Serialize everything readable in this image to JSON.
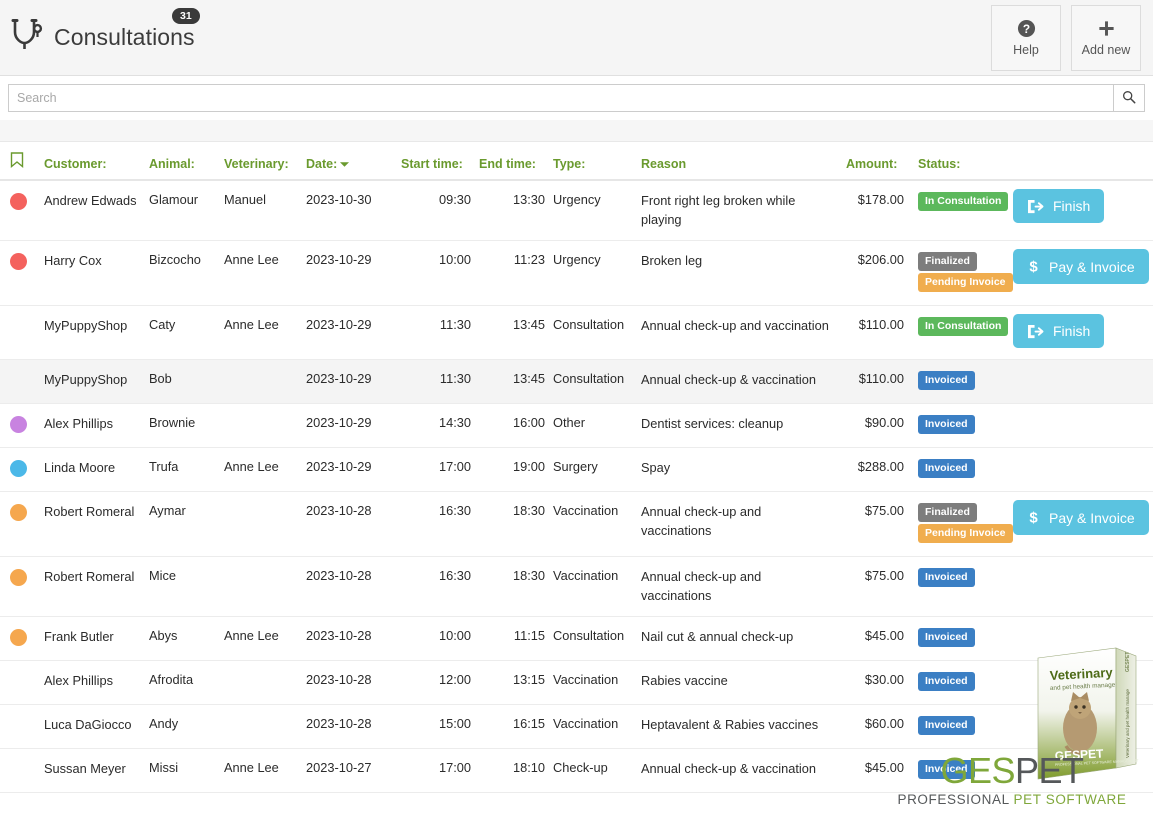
{
  "header": {
    "title": "Consultations",
    "badge_count": "31",
    "icon": "stethoscope-icon",
    "buttons": [
      {
        "label": "Help",
        "icon": "question-circle-icon"
      },
      {
        "label": "Add new",
        "icon": "plus-icon"
      }
    ]
  },
  "search": {
    "placeholder": "Search",
    "value": "",
    "button_icon": "search-icon"
  },
  "table": {
    "flag_icon": "bookmark-icon",
    "columns": {
      "customer": "Customer:",
      "animal": "Animal:",
      "veterinary": "Veterinary:",
      "date": "Date:",
      "date_sort": "descending",
      "start_time": "Start time:",
      "end_time": "End time:",
      "type": "Type:",
      "reason": "Reason",
      "amount": "Amount:",
      "status": "Status:"
    },
    "rows": [
      {
        "dot": "#f4625e",
        "customer": "Andrew Edwads",
        "animal": "Glamour",
        "veterinary": "Manuel",
        "date": "2023-10-30",
        "start": "09:30",
        "end": "13:30",
        "type": "Urgency",
        "type_style": "urgency",
        "reason": "Front right leg broken while playing",
        "amount": "$178.00",
        "badges": [
          {
            "label": "In Consultation",
            "style": "b-inconsult"
          }
        ],
        "action": {
          "label": "Finish",
          "icon": "sign-out-icon"
        },
        "highlight": false
      },
      {
        "dot": "#f4625e",
        "customer": "Harry Cox",
        "animal": "Bizcocho",
        "veterinary": "Anne Lee",
        "date": "2023-10-29",
        "start": "10:00",
        "end": "11:23",
        "type": "Urgency",
        "type_style": "urgency",
        "reason": "Broken leg",
        "amount": "$206.00",
        "badges": [
          {
            "label": "Finalized",
            "style": "b-finalized"
          },
          {
            "label": "Pending Invoice",
            "style": "b-pending"
          }
        ],
        "action": {
          "label": "Pay & Invoice",
          "icon": "dollar-icon"
        },
        "highlight": false
      },
      {
        "dot": "",
        "customer": "MyPuppyShop",
        "animal": "Caty",
        "veterinary": "Anne Lee",
        "date": "2023-10-29",
        "start": "11:30",
        "end": "13:45",
        "type": "Consultation",
        "type_style": "",
        "reason": "Annual check-up and vaccination",
        "amount": "$110.00",
        "badges": [
          {
            "label": "In Consultation",
            "style": "b-inconsult"
          }
        ],
        "action": {
          "label": "Finish",
          "icon": "sign-out-icon"
        },
        "highlight": false
      },
      {
        "dot": "",
        "customer": "MyPuppyShop",
        "animal": "Bob",
        "veterinary": "",
        "date": "2023-10-29",
        "start": "11:30",
        "end": "13:45",
        "type": "Consultation",
        "type_style": "",
        "reason": "Annual check-up & vaccination",
        "amount": "$110.00",
        "badges": [
          {
            "label": "Invoiced",
            "style": "b-invoiced"
          }
        ],
        "action": null,
        "highlight": true
      },
      {
        "dot": "#c883e0",
        "customer": "Alex Phillips",
        "animal": "Brownie",
        "veterinary": "",
        "date": "2023-10-29",
        "start": "14:30",
        "end": "16:00",
        "type": "Other",
        "type_style": "",
        "reason": "Dentist services: cleanup",
        "amount": "$90.00",
        "badges": [
          {
            "label": "Invoiced",
            "style": "b-invoiced"
          }
        ],
        "action": null,
        "highlight": false
      },
      {
        "dot": "#4bb8e8",
        "customer": "Linda Moore",
        "animal": "Trufa",
        "veterinary": "Anne Lee",
        "date": "2023-10-29",
        "start": "17:00",
        "end": "19:00",
        "type": "Surgery",
        "type_style": "",
        "reason": "Spay",
        "amount": "$288.00",
        "badges": [
          {
            "label": "Invoiced",
            "style": "b-invoiced"
          }
        ],
        "action": null,
        "highlight": false
      },
      {
        "dot": "#f5a council",
        "customer": "Robert Romeral",
        "animal": "Aymar",
        "veterinary": "",
        "date": "2023-10-28",
        "start": "16:30",
        "end": "18:30",
        "type": "Vaccination",
        "type_style": "",
        "reason": "Annual check-up and vaccinations",
        "amount": "$75.00",
        "badges": [
          {
            "label": "Finalized",
            "style": "b-finalized"
          },
          {
            "label": "Pending Invoice",
            "style": "b-pending"
          }
        ],
        "action": {
          "label": "Pay & Invoice",
          "icon": "dollar-icon"
        },
        "highlight": false
      },
      {
        "dot": "#f5a74e",
        "customer": "Robert Romeral",
        "animal": "Mice",
        "veterinary": "",
        "date": "2023-10-28",
        "start": "16:30",
        "end": "18:30",
        "type": "Vaccination",
        "type_style": "",
        "reason": "Annual check-up and vaccinations",
        "amount": "$75.00",
        "badges": [
          {
            "label": "Invoiced",
            "style": "b-invoiced"
          }
        ],
        "action": null,
        "highlight": false
      },
      {
        "dot": "#f5a74e",
        "customer": "Frank Butler",
        "animal": "Abys",
        "veterinary": "Anne Lee",
        "date": "2023-10-28",
        "start": "10:00",
        "end": "11:15",
        "type": "Consultation",
        "type_style": "",
        "reason": "Nail cut & annual check-up",
        "amount": "$45.00",
        "badges": [
          {
            "label": "Invoiced",
            "style": "b-invoiced"
          }
        ],
        "action": null,
        "highlight": false
      },
      {
        "dot": "",
        "customer": "Alex Phillips",
        "animal": "Afrodita",
        "veterinary": "",
        "date": "2023-10-28",
        "start": "12:00",
        "end": "13:15",
        "type": "Vaccination",
        "type_style": "",
        "reason": "Rabies vaccine",
        "amount": "$30.00",
        "badges": [
          {
            "label": "Invoiced",
            "style": "b-invoiced"
          }
        ],
        "action": null,
        "highlight": false
      },
      {
        "dot": "",
        "customer": "Luca DaGiocco",
        "animal": "Andy",
        "veterinary": "",
        "date": "2023-10-28",
        "start": "15:00",
        "end": "16:15",
        "type": "Vaccination",
        "type_style": "",
        "reason": "Heptavalent & Rabies vaccines",
        "amount": "$60.00",
        "badges": [
          {
            "label": "Invoiced",
            "style": "b-invoiced"
          }
        ],
        "action": null,
        "highlight": false
      },
      {
        "dot": "",
        "customer": "Sussan Meyer",
        "animal": "Missi",
        "veterinary": "Anne Lee",
        "date": "2023-10-27",
        "start": "17:00",
        "end": "18:10",
        "type": "Check-up",
        "type_style": "",
        "reason": "Annual check-up & vaccination",
        "amount": "$45.00",
        "badges": [
          {
            "label": "Invoiced",
            "style": "b-invoiced"
          }
        ],
        "action": null,
        "highlight": false
      }
    ]
  },
  "logo": {
    "name_part1": "GES",
    "name_part2": "PET",
    "tagline_part1": "PROFESSIONAL ",
    "tagline_part2": "PET SOFTWARE",
    "box_title": "Veterinary",
    "box_subtitle": "and pet health manage",
    "box_brand": "GESPET",
    "box_spine": "Veterinary and pet health manage"
  },
  "colors": {
    "header_green": "#6a9a2e",
    "urgency_red": "#c9473f",
    "button_blue": "#5bc3e0",
    "badge_green": "#5cb85c",
    "badge_gray": "#7d7d7d",
    "badge_orange": "#f0ad4e",
    "badge_blue": "#3b7fc4"
  }
}
